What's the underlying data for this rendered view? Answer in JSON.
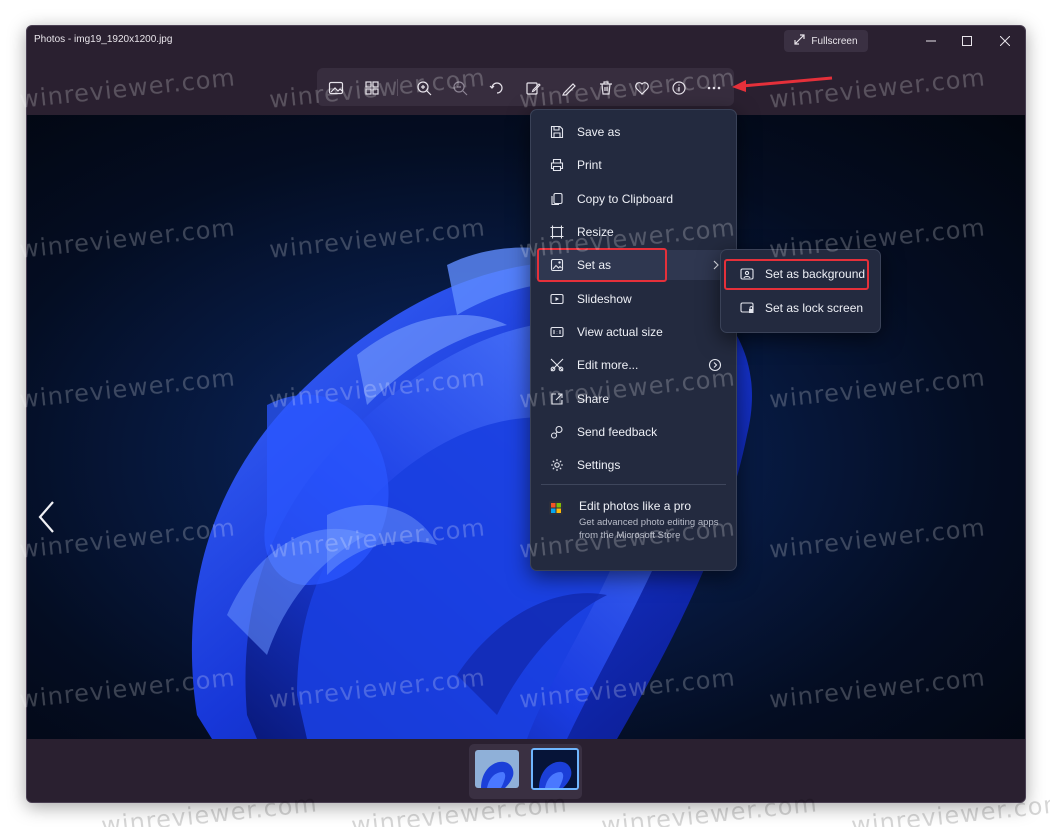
{
  "window": {
    "title": "Photos - img19_1920x1200.jpg",
    "fullscreen_label": "Fullscreen"
  },
  "toolbar": {
    "buttons": [
      {
        "name": "image-edit-icon"
      },
      {
        "name": "gallery-view-icon"
      },
      {
        "name": "zoom-in-icon"
      },
      {
        "name": "zoom-out-icon"
      },
      {
        "name": "rotate-icon"
      },
      {
        "name": "edit-image-icon"
      },
      {
        "name": "draw-icon"
      },
      {
        "name": "delete-icon"
      },
      {
        "name": "favorite-icon"
      },
      {
        "name": "info-icon"
      },
      {
        "name": "more-options-icon"
      }
    ]
  },
  "menu": {
    "items": [
      {
        "label": "Save as",
        "icon": "save-icon"
      },
      {
        "label": "Print",
        "icon": "print-icon"
      },
      {
        "label": "Copy to Clipboard",
        "icon": "copy-icon"
      },
      {
        "label": "Resize",
        "icon": "resize-icon"
      },
      {
        "label": "Set as",
        "icon": "set-as-icon"
      },
      {
        "label": "Slideshow",
        "icon": "slideshow-icon"
      },
      {
        "label": "View actual size",
        "icon": "actual-size-icon"
      },
      {
        "label": "Edit more...",
        "icon": "edit-more-icon"
      },
      {
        "label": "Share",
        "icon": "share-icon"
      },
      {
        "label": "Send feedback",
        "icon": "feedback-icon"
      },
      {
        "label": "Settings",
        "icon": "settings-icon"
      }
    ],
    "promo": {
      "title": "Edit photos like a pro",
      "description": "Get advanced photo editing apps from the Microsoft Store"
    }
  },
  "submenu": {
    "items": [
      {
        "label": "Set as background",
        "icon": "background-icon"
      },
      {
        "label": "Set as lock screen",
        "icon": "lock-screen-icon"
      }
    ]
  },
  "watermark": "winreviewer.com",
  "colors": {
    "highlight": "#e5303a",
    "menu_bg": "#232a3f",
    "window_bg": "#2a2030"
  }
}
